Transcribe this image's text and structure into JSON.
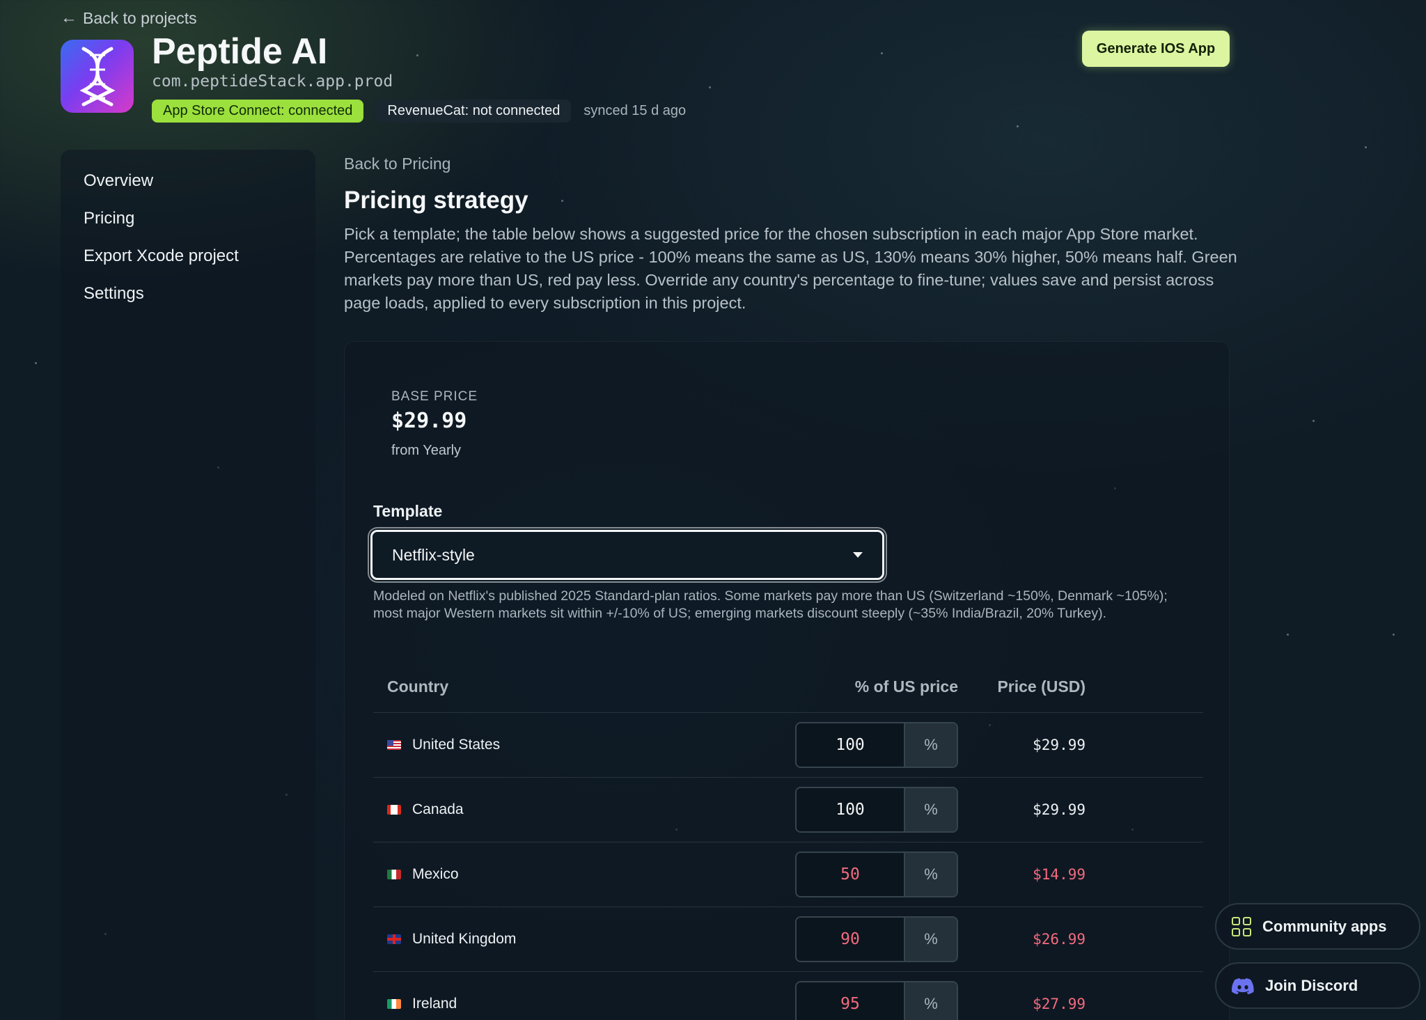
{
  "header": {
    "back_label": "Back to projects",
    "app_title": "Peptide AI",
    "bundle_id": "com.peptideStack.app.prod",
    "badge_asc": "App Store Connect: connected",
    "badge_rc": "RevenueCat: not connected",
    "synced": "synced 15 d ago",
    "generate_label": "Generate IOS App",
    "accent_color": "#9be03c"
  },
  "sidebar": {
    "items": [
      {
        "label": "Overview"
      },
      {
        "label": "Pricing"
      },
      {
        "label": "Export Xcode project"
      },
      {
        "label": "Settings"
      }
    ]
  },
  "main": {
    "back_label": "Back to Pricing",
    "title": "Pricing strategy",
    "description": "Pick a template; the table below shows a suggested price for the chosen subscription in each major App Store market. Percentages are relative to the US price - 100% means the same as US, 130% means 30% higher, 50% means half. Green markets pay more than US, red pay less. Override any country's percentage to fine-tune; values save and persist across page loads, applied to every subscription in this project.",
    "base_price_label": "BASE PRICE",
    "base_price": "$29.99",
    "base_from": "from Yearly",
    "template_label": "Template",
    "template_value": "Netflix-style",
    "template_note": "Modeled on Netflix's published 2025 Standard-plan ratios. Some markets pay more than US (Switzerland ~150%, Denmark ~105%); most major Western markets sit within +/-10% of US; emerging markets discount steeply (~35% India/Brazil, 20% Turkey).",
    "table": {
      "headers": {
        "country": "Country",
        "pct": "% of US price",
        "price": "Price (USD)"
      },
      "percent_suffix": "%",
      "rows": [
        {
          "country": "United States",
          "flag": "us-flag-icon",
          "pct": "100",
          "price": "$29.99"
        },
        {
          "country": "Canada",
          "flag": "canada-flag-icon",
          "pct": "100",
          "price": "$29.99"
        },
        {
          "country": "Mexico",
          "flag": "mexico-flag-icon",
          "pct": "50",
          "price": "$14.99"
        },
        {
          "country": "United Kingdom",
          "flag": "uk-flag-icon",
          "pct": "90",
          "price": "$26.99"
        },
        {
          "country": "Ireland",
          "flag": "ireland-flag-icon",
          "pct": "95",
          "price": "$27.99"
        }
      ],
      "lower_price_color": "#f36b7f"
    }
  },
  "floating": {
    "community_label": "Community apps",
    "discord_label": "Join Discord"
  }
}
